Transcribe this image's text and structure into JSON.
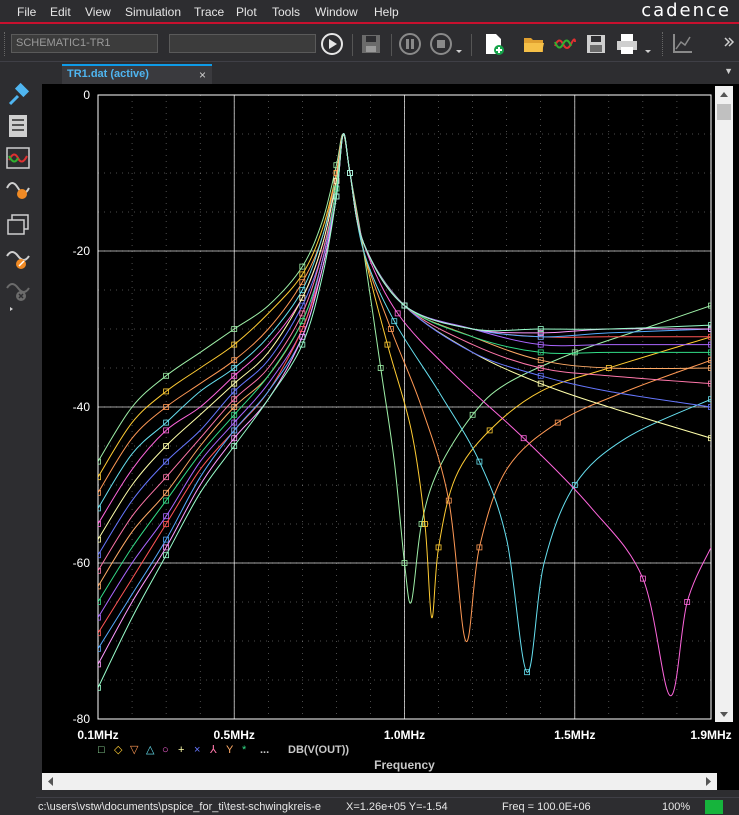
{
  "menu": [
    "File",
    "Edit",
    "View",
    "Simulation",
    "Trace",
    "Plot",
    "Tools",
    "Window",
    "Help"
  ],
  "brand": "cadence",
  "toolbar": {
    "profile_value": "SCHEMATIC1-TR1",
    "command_value": ""
  },
  "tab": {
    "label": "TR1.dat (active)",
    "close": "×",
    "dropdown": "▼"
  },
  "plot": {
    "trace_expression": "DB(V(OUT))",
    "trace_markers": [
      "□",
      "◇",
      "▽",
      "△",
      "○",
      "+",
      "×",
      "⅄",
      "Y",
      "*"
    ],
    "trace_dots": "...",
    "colors": {
      "background": "#000000",
      "grid": "#ffffff",
      "label": "#ffffff",
      "legend": "#c8c8c8"
    }
  },
  "chart_data": {
    "type": "line",
    "title": "",
    "xlabel": "Frequency",
    "ylabel": "",
    "x_ticks": [
      {
        "value": 0.1,
        "label": "0.1MHz"
      },
      {
        "value": 0.5,
        "label": "0.5MHz"
      },
      {
        "value": 1.0,
        "label": "1.0MHz"
      },
      {
        "value": 1.5,
        "label": "1.5MHz"
      },
      {
        "value": 1.9,
        "label": "1.9MHz"
      }
    ],
    "y_ticks": [
      {
        "value": 0,
        "label": "0"
      },
      {
        "value": -20,
        "label": "-20"
      },
      {
        "value": -40,
        "label": "-40"
      },
      {
        "value": -60,
        "label": "-60"
      },
      {
        "value": -80,
        "label": "-80"
      }
    ],
    "xlim": [
      0.1,
      1.9
    ],
    "ylim": [
      -80,
      0
    ],
    "grid": true,
    "x_unit": "MHz",
    "y_unit": "dB",
    "peak_x": 0.82,
    "series": [
      {
        "color": "#9ef0a8",
        "points": [
          [
            0.1,
            -47
          ],
          [
            0.2,
            -40
          ],
          [
            0.3,
            -36
          ],
          [
            0.4,
            -33
          ],
          [
            0.5,
            -30
          ],
          [
            0.6,
            -27
          ],
          [
            0.7,
            -22
          ],
          [
            0.76,
            -16
          ],
          [
            0.8,
            -9
          ],
          [
            0.82,
            -5
          ],
          [
            0.84,
            -10
          ],
          [
            0.88,
            -20
          ],
          [
            0.93,
            -35
          ],
          [
            0.97,
            -47
          ],
          [
            1.0,
            -60
          ],
          [
            1.02,
            -65
          ],
          [
            1.05,
            -55
          ],
          [
            1.1,
            -48
          ],
          [
            1.2,
            -41
          ],
          [
            1.3,
            -37
          ],
          [
            1.5,
            -33
          ],
          [
            1.7,
            -30
          ],
          [
            1.9,
            -27
          ]
        ]
      },
      {
        "color": "#ffcc33",
        "points": [
          [
            0.1,
            -49
          ],
          [
            0.2,
            -42
          ],
          [
            0.3,
            -38
          ],
          [
            0.4,
            -35
          ],
          [
            0.5,
            -32
          ],
          [
            0.6,
            -28
          ],
          [
            0.7,
            -23
          ],
          [
            0.76,
            -17
          ],
          [
            0.8,
            -10
          ],
          [
            0.82,
            -5
          ],
          [
            0.84,
            -10
          ],
          [
            0.88,
            -20
          ],
          [
            0.95,
            -32
          ],
          [
            1.02,
            -43
          ],
          [
            1.06,
            -55
          ],
          [
            1.08,
            -67
          ],
          [
            1.1,
            -58
          ],
          [
            1.15,
            -49
          ],
          [
            1.25,
            -43
          ],
          [
            1.4,
            -38
          ],
          [
            1.6,
            -35
          ],
          [
            1.9,
            -31
          ]
        ]
      },
      {
        "color": "#ff9955",
        "points": [
          [
            0.1,
            -51
          ],
          [
            0.2,
            -44
          ],
          [
            0.3,
            -40
          ],
          [
            0.4,
            -37
          ],
          [
            0.5,
            -34
          ],
          [
            0.6,
            -30
          ],
          [
            0.7,
            -24
          ],
          [
            0.76,
            -18
          ],
          [
            0.8,
            -10
          ],
          [
            0.82,
            -5
          ],
          [
            0.84,
            -10
          ],
          [
            0.88,
            -20
          ],
          [
            0.96,
            -30
          ],
          [
            1.05,
            -40
          ],
          [
            1.13,
            -52
          ],
          [
            1.18,
            -70
          ],
          [
            1.22,
            -58
          ],
          [
            1.3,
            -48
          ],
          [
            1.45,
            -42
          ],
          [
            1.65,
            -38
          ],
          [
            1.9,
            -34
          ]
        ]
      },
      {
        "color": "#66e0f0",
        "points": [
          [
            0.1,
            -53
          ],
          [
            0.2,
            -46
          ],
          [
            0.3,
            -42
          ],
          [
            0.4,
            -38
          ],
          [
            0.5,
            -35
          ],
          [
            0.6,
            -31
          ],
          [
            0.7,
            -25
          ],
          [
            0.76,
            -18
          ],
          [
            0.8,
            -11
          ],
          [
            0.82,
            -5
          ],
          [
            0.84,
            -10
          ],
          [
            0.88,
            -20
          ],
          [
            0.97,
            -29
          ],
          [
            1.1,
            -38
          ],
          [
            1.22,
            -47
          ],
          [
            1.3,
            -57
          ],
          [
            1.36,
            -74
          ],
          [
            1.41,
            -60
          ],
          [
            1.5,
            -50
          ],
          [
            1.65,
            -44
          ],
          [
            1.9,
            -39
          ]
        ]
      },
      {
        "color": "#ff66dd",
        "points": [
          [
            0.1,
            -55
          ],
          [
            0.2,
            -48
          ],
          [
            0.3,
            -43
          ],
          [
            0.4,
            -40
          ],
          [
            0.5,
            -36
          ],
          [
            0.6,
            -32
          ],
          [
            0.7,
            -26
          ],
          [
            0.76,
            -19
          ],
          [
            0.8,
            -11
          ],
          [
            0.82,
            -5
          ],
          [
            0.84,
            -10
          ],
          [
            0.88,
            -19
          ],
          [
            0.98,
            -28
          ],
          [
            1.15,
            -36
          ],
          [
            1.35,
            -44
          ],
          [
            1.55,
            -53
          ],
          [
            1.7,
            -62
          ],
          [
            1.78,
            -77
          ],
          [
            1.83,
            -65
          ],
          [
            1.9,
            -58
          ]
        ]
      },
      {
        "color": "#ffffaa",
        "points": [
          [
            0.1,
            -57
          ],
          [
            0.2,
            -50
          ],
          [
            0.3,
            -45
          ],
          [
            0.4,
            -41
          ],
          [
            0.5,
            -37
          ],
          [
            0.6,
            -33
          ],
          [
            0.7,
            -26
          ],
          [
            0.76,
            -19
          ],
          [
            0.8,
            -11
          ],
          [
            0.82,
            -5
          ],
          [
            0.84,
            -10
          ],
          [
            0.88,
            -19
          ],
          [
            1.0,
            -27
          ],
          [
            1.2,
            -33
          ],
          [
            1.4,
            -37
          ],
          [
            1.6,
            -40
          ],
          [
            1.9,
            -44
          ]
        ]
      },
      {
        "color": "#6677ff",
        "points": [
          [
            0.1,
            -59
          ],
          [
            0.2,
            -52
          ],
          [
            0.3,
            -47
          ],
          [
            0.4,
            -43
          ],
          [
            0.5,
            -38
          ],
          [
            0.6,
            -34
          ],
          [
            0.7,
            -27
          ],
          [
            0.76,
            -20
          ],
          [
            0.8,
            -12
          ],
          [
            0.82,
            -5
          ],
          [
            0.84,
            -10
          ],
          [
            0.88,
            -19
          ],
          [
            1.0,
            -27
          ],
          [
            1.2,
            -33
          ],
          [
            1.4,
            -36
          ],
          [
            1.6,
            -38
          ],
          [
            1.9,
            -40
          ]
        ]
      },
      {
        "color": "#ff77aa",
        "points": [
          [
            0.1,
            -61
          ],
          [
            0.2,
            -54
          ],
          [
            0.3,
            -49
          ],
          [
            0.4,
            -44
          ],
          [
            0.5,
            -39
          ],
          [
            0.6,
            -35
          ],
          [
            0.7,
            -28
          ],
          [
            0.76,
            -20
          ],
          [
            0.8,
            -12
          ],
          [
            0.82,
            -5
          ],
          [
            0.84,
            -10
          ],
          [
            0.88,
            -19
          ],
          [
            1.0,
            -27
          ],
          [
            1.2,
            -32
          ],
          [
            1.4,
            -35
          ],
          [
            1.6,
            -36
          ],
          [
            1.9,
            -37
          ]
        ]
      },
      {
        "color": "#ffaa66",
        "points": [
          [
            0.1,
            -63
          ],
          [
            0.2,
            -56
          ],
          [
            0.3,
            -51
          ],
          [
            0.4,
            -45
          ],
          [
            0.5,
            -40
          ],
          [
            0.6,
            -36
          ],
          [
            0.7,
            -29
          ],
          [
            0.76,
            -21
          ],
          [
            0.8,
            -12
          ],
          [
            0.82,
            -5
          ],
          [
            0.84,
            -10
          ],
          [
            0.88,
            -19
          ],
          [
            1.0,
            -27
          ],
          [
            1.2,
            -31
          ],
          [
            1.4,
            -34
          ],
          [
            1.6,
            -35
          ],
          [
            1.9,
            -35
          ]
        ]
      },
      {
        "color": "#33dd88",
        "points": [
          [
            0.1,
            -65
          ],
          [
            0.2,
            -58
          ],
          [
            0.3,
            -52
          ],
          [
            0.4,
            -46
          ],
          [
            0.5,
            -41
          ],
          [
            0.6,
            -36
          ],
          [
            0.7,
            -29
          ],
          [
            0.76,
            -21
          ],
          [
            0.8,
            -12
          ],
          [
            0.82,
            -5
          ],
          [
            0.84,
            -10
          ],
          [
            0.88,
            -19
          ],
          [
            1.0,
            -27
          ],
          [
            1.2,
            -31
          ],
          [
            1.4,
            -33
          ],
          [
            1.6,
            -33
          ],
          [
            1.9,
            -33
          ]
        ]
      },
      {
        "color": "#aa66ff",
        "points": [
          [
            0.1,
            -67
          ],
          [
            0.2,
            -60
          ],
          [
            0.3,
            -54
          ],
          [
            0.4,
            -47
          ],
          [
            0.5,
            -42
          ],
          [
            0.6,
            -37
          ],
          [
            0.7,
            -30
          ],
          [
            0.76,
            -21
          ],
          [
            0.8,
            -13
          ],
          [
            0.82,
            -5
          ],
          [
            0.84,
            -10
          ],
          [
            0.88,
            -19
          ],
          [
            1.0,
            -27
          ],
          [
            1.2,
            -30
          ],
          [
            1.4,
            -32
          ],
          [
            1.6,
            -32
          ],
          [
            1.9,
            -32
          ]
        ]
      },
      {
        "color": "#ff5555",
        "points": [
          [
            0.1,
            -69
          ],
          [
            0.2,
            -62
          ],
          [
            0.3,
            -55
          ],
          [
            0.4,
            -48
          ],
          [
            0.5,
            -43
          ],
          [
            0.6,
            -38
          ],
          [
            0.7,
            -30
          ],
          [
            0.76,
            -22
          ],
          [
            0.8,
            -13
          ],
          [
            0.82,
            -5
          ],
          [
            0.84,
            -10
          ],
          [
            0.88,
            -19
          ],
          [
            1.0,
            -27
          ],
          [
            1.2,
            -30
          ],
          [
            1.4,
            -31
          ],
          [
            1.6,
            -31
          ],
          [
            1.9,
            -31
          ]
        ]
      },
      {
        "color": "#55aaff",
        "points": [
          [
            0.1,
            -71
          ],
          [
            0.2,
            -64
          ],
          [
            0.3,
            -57
          ],
          [
            0.4,
            -49
          ],
          [
            0.5,
            -43
          ],
          [
            0.6,
            -38
          ],
          [
            0.7,
            -31
          ],
          [
            0.76,
            -22
          ],
          [
            0.8,
            -13
          ],
          [
            0.82,
            -5
          ],
          [
            0.84,
            -10
          ],
          [
            0.88,
            -19
          ],
          [
            1.0,
            -27
          ],
          [
            1.2,
            -30
          ],
          [
            1.4,
            -31
          ],
          [
            1.6,
            -30.5
          ],
          [
            1.9,
            -30
          ]
        ]
      },
      {
        "color": "#ff99ff",
        "points": [
          [
            0.1,
            -73
          ],
          [
            0.2,
            -65
          ],
          [
            0.3,
            -58
          ],
          [
            0.4,
            -50
          ],
          [
            0.5,
            -44
          ],
          [
            0.6,
            -39
          ],
          [
            0.7,
            -31
          ],
          [
            0.76,
            -22
          ],
          [
            0.8,
            -13
          ],
          [
            0.82,
            -5
          ],
          [
            0.84,
            -10
          ],
          [
            0.88,
            -19
          ],
          [
            1.0,
            -27
          ],
          [
            1.2,
            -30
          ],
          [
            1.4,
            -30.5
          ],
          [
            1.6,
            -30
          ],
          [
            1.9,
            -30
          ]
        ]
      },
      {
        "color": "#99ffcc",
        "points": [
          [
            0.1,
            -76
          ],
          [
            0.2,
            -67
          ],
          [
            0.3,
            -59
          ],
          [
            0.4,
            -51
          ],
          [
            0.5,
            -45
          ],
          [
            0.6,
            -39
          ],
          [
            0.7,
            -32
          ],
          [
            0.76,
            -23
          ],
          [
            0.8,
            -13
          ],
          [
            0.82,
            -5
          ],
          [
            0.84,
            -10
          ],
          [
            0.88,
            -19
          ],
          [
            1.0,
            -27
          ],
          [
            1.2,
            -30
          ],
          [
            1.4,
            -30
          ],
          [
            1.6,
            -30
          ],
          [
            1.9,
            -29.5
          ]
        ]
      }
    ]
  },
  "status": {
    "path": "c:\\users\\vstw\\documents\\pspice_for_ti\\test-schwingkreis-e",
    "xy": "X=1.26e+05  Y=-1.54",
    "freq": "Freq =  100.0E+06",
    "zoom": "100%"
  }
}
